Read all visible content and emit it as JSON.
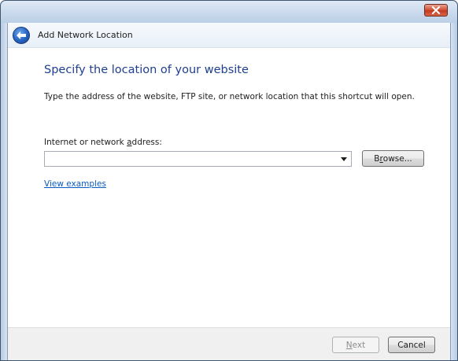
{
  "window": {
    "title": "Add Network Location"
  },
  "icons": {
    "back": "back-arrow-icon",
    "close": "close-icon",
    "dropdown": "chevron-down-icon"
  },
  "page": {
    "heading": "Specify the location of your website",
    "description": "Type the address of the website, FTP site, or network location that this shortcut will open."
  },
  "address": {
    "label_pre": "Internet or network ",
    "label_accel": "a",
    "label_post": "ddress:",
    "value": "",
    "placeholder": ""
  },
  "browse": {
    "label_pre": "B",
    "label_accel": "r",
    "label_post": "owse..."
  },
  "link": {
    "view_examples": "View examples"
  },
  "footer": {
    "next_accel": "N",
    "next_post": "ext",
    "cancel": "Cancel"
  },
  "colors": {
    "heading": "#1f3f8f",
    "link": "#0a5bc4",
    "close_button": "#c23a1f",
    "back_button": "#2563c2"
  }
}
